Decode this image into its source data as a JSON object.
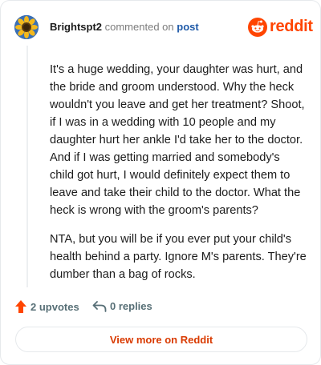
{
  "header": {
    "author": "Brightspt2",
    "commented_on": "commented on",
    "post_link": "post",
    "logo_text": "reddit"
  },
  "comment": {
    "paragraphs": [
      "It's a huge wedding, your daughter was hurt, and the bride and groom understood. Why the heck wouldn't you leave and get her treatment? Shoot, if I was in a wedding with 10 people and my daughter hurt her ankle I'd take her to the doctor. And if I was getting married and somebody's child got hurt, I would definitely expect them to leave and take their child to the doctor. What the heck is wrong with the groom's parents?",
      "NTA, but you will be if you ever put your child's health behind a party. Ignore M's parents. They're dumber than a bag of rocks."
    ]
  },
  "footer": {
    "upvotes": "2 upvotes",
    "replies": "0 replies"
  },
  "cta": {
    "label": "View more on Reddit"
  },
  "colors": {
    "reddit_orange": "#ff4500",
    "cta_text": "#d93a00",
    "meta_gray": "#7c7c7c",
    "link_blue": "#1f5aa8"
  },
  "icons": [
    "avatar-sunflower",
    "reddit-snoo-icon",
    "upvote-arrow-icon",
    "reply-arrow-icon"
  ]
}
